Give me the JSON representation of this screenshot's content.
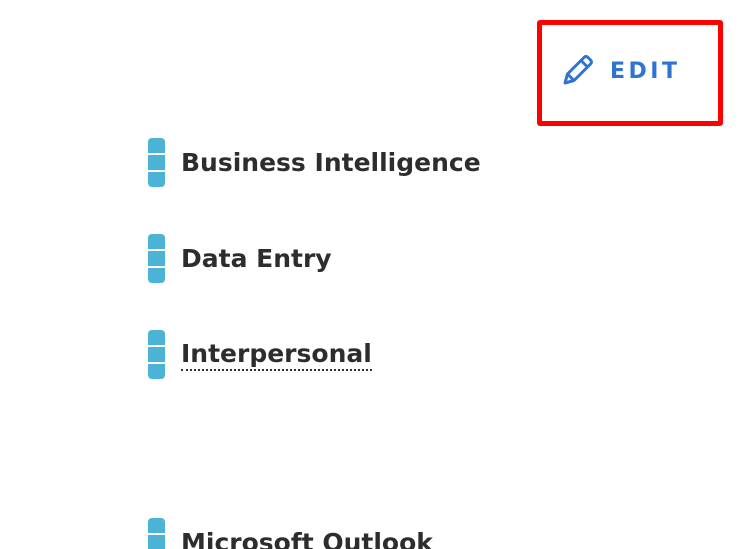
{
  "edit_button": {
    "label": "EDIT",
    "icon": "pencil-icon",
    "color": "#2f74d0"
  },
  "highlight_color": "#ff0000",
  "level_color": "#4ab3d6",
  "skills": [
    {
      "label": "Business Intelligence"
    },
    {
      "label": "Data Entry"
    },
    {
      "label": "Interpersonal"
    },
    {
      "label": "Microsoft Outlook"
    }
  ]
}
